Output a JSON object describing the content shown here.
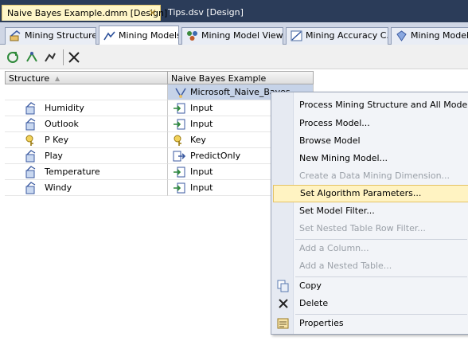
{
  "doc_tabs": {
    "active": "Naive Bayes Example.dmm [Design]",
    "inactive": "Tips.dsv [Design]",
    "close_symbol": "×"
  },
  "designer_tabs": [
    {
      "label": "Mining Structure",
      "icon": "mining-structure-icon"
    },
    {
      "label": "Mining Models",
      "icon": "mining-models-icon"
    },
    {
      "label": "Mining Model Viewer",
      "icon": "model-viewer-icon"
    },
    {
      "label": "Mining Accuracy C...",
      "icon": "accuracy-chart-icon"
    },
    {
      "label": "Mining Model Pr",
      "icon": "prediction-icon"
    }
  ],
  "toolbar": {
    "buttons": [
      "new-model-icon",
      "process-icon",
      "refresh-icon",
      "delete-icon"
    ]
  },
  "grid": {
    "header_structure": "Structure",
    "header_sort_arrow": "▲",
    "header_model": "Naive Bayes Example",
    "algorithm": "Microsoft_Naive_Bayes",
    "rows": [
      {
        "name": "Humidity",
        "usage": "Input"
      },
      {
        "name": "Outlook",
        "usage": "Input"
      },
      {
        "name": "P Key",
        "usage": "Key"
      },
      {
        "name": "Play",
        "usage": "PredictOnly"
      },
      {
        "name": "Temperature",
        "usage": "Input"
      },
      {
        "name": "Windy",
        "usage": "Input"
      }
    ]
  },
  "context_menu": {
    "items": [
      {
        "label": "Process Mining Structure and All Models...",
        "enabled": true
      },
      {
        "label": "Process Model...",
        "enabled": true
      },
      {
        "label": "Browse Model",
        "enabled": true
      },
      {
        "label": "New Mining Model...",
        "enabled": true
      },
      {
        "label": "Create a Data Mining Dimension...",
        "enabled": false
      },
      {
        "label": "Set Algorithm Parameters...",
        "enabled": true,
        "highlighted": true
      },
      {
        "label": "Set Model Filter...",
        "enabled": true
      },
      {
        "label": "Set Nested Table Row Filter...",
        "enabled": false
      },
      {
        "label": "Add a Column...",
        "enabled": false
      },
      {
        "label": "Add a Nested Table...",
        "enabled": false
      },
      {
        "label": "Copy",
        "enabled": true,
        "icon": "copy-icon"
      },
      {
        "label": "Delete",
        "enabled": true,
        "icon": "delete-icon"
      },
      {
        "label": "Properties",
        "enabled": true,
        "icon": "properties-icon"
      }
    ]
  },
  "colors": {
    "title_bar": "#2b3c59",
    "active_doc_tab": "#fff6c8",
    "menu_highlight": "#fff3c2"
  }
}
